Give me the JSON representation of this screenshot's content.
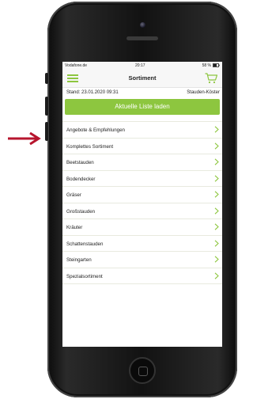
{
  "status_bar": {
    "carrier": "Vodafone.de",
    "time": "20:17",
    "battery": "58 %"
  },
  "nav": {
    "title": "Sortiment",
    "menu_icon": "hamburger-icon",
    "cart_icon": "cart-icon"
  },
  "info": {
    "stand": "Stand: 23.01.2020 09:31",
    "supplier": "Stauden-Köster"
  },
  "load_button": "Aktuelle Liste laden",
  "categories": [
    "Angebote & Empfehlungen",
    "Komplettes Sortiment",
    "Beetstauden",
    "Bodendecker",
    "Gräser",
    "Großstauden",
    "Kräuter",
    "Schattenstauden",
    "Steingarten",
    "Spezialsortiment"
  ],
  "colors": {
    "accent": "#8dc63f",
    "arrow": "#b7152e"
  }
}
